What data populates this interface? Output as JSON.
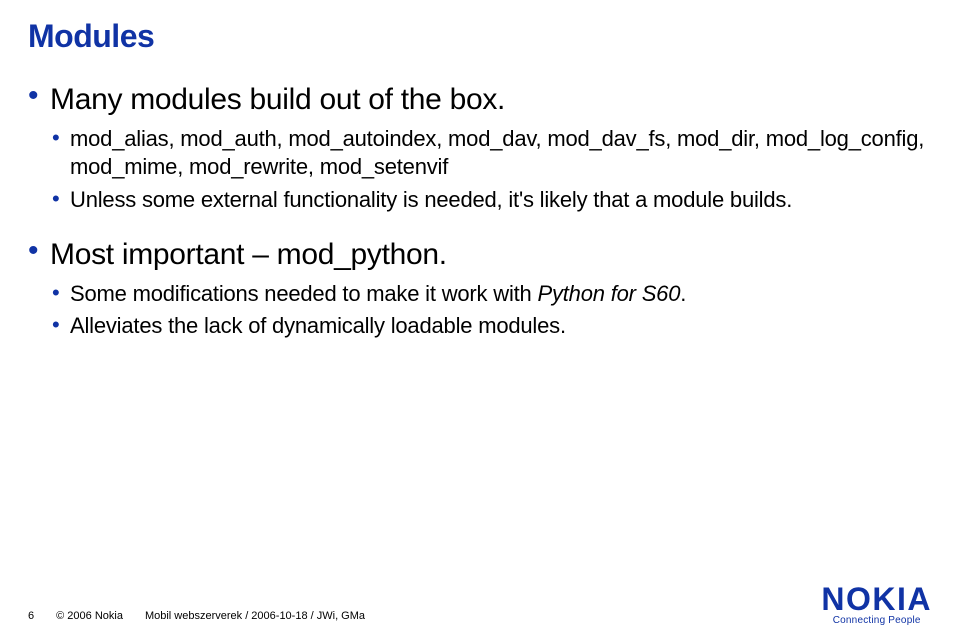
{
  "title": "Modules",
  "bullets": {
    "group1": {
      "l1": "Many modules build out of the box.",
      "sub": [
        "mod_alias, mod_auth, mod_autoindex, mod_dav, mod_dav_fs, mod_dir, mod_log_config, mod_mime, mod_rewrite, mod_setenvif",
        "Unless some external functionality is needed, it's likely that a module builds."
      ]
    },
    "group2": {
      "l1": "Most important – mod_python.",
      "sub_pre": "Some modifications needed to make it work with ",
      "sub_ital": "Python for S60",
      "sub_post": ".",
      "sub2": "Alleviates the lack of dynamically loadable modules."
    }
  },
  "footer": {
    "page": "6",
    "copyright": "© 2006 Nokia",
    "path": "Mobil webszerverek / 2006-10-18 / JWi, GMa"
  },
  "logo": {
    "word": "NOKIA",
    "tag": "Connecting People"
  }
}
